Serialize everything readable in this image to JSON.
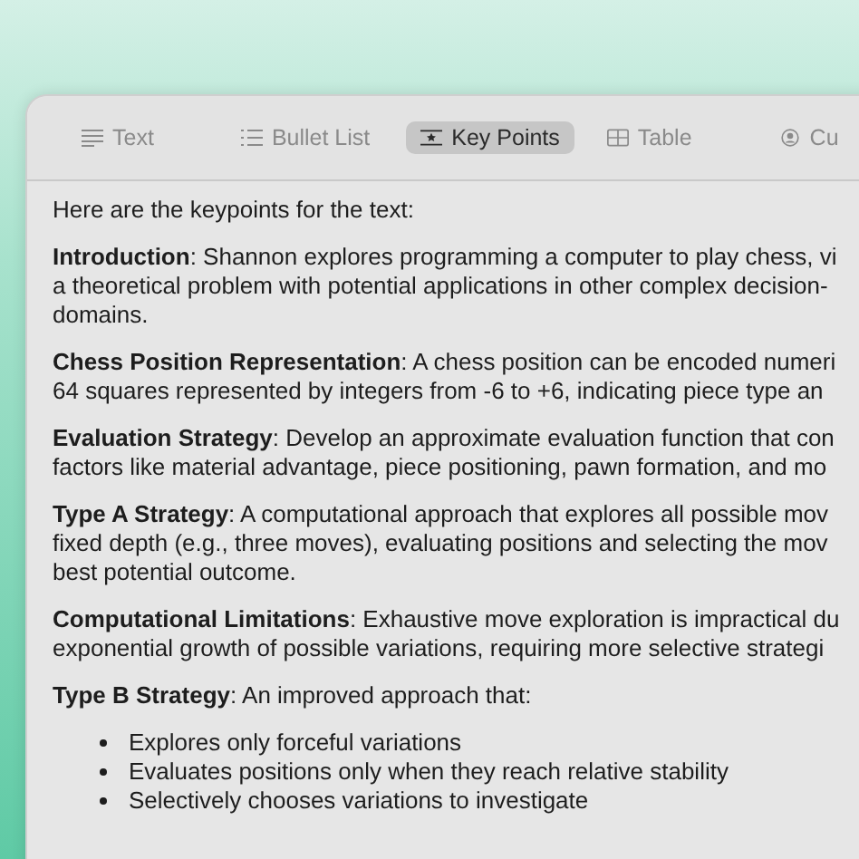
{
  "tabs": [
    {
      "label": "Text",
      "kind": "lines",
      "selected": false
    },
    {
      "label": "Bullet List",
      "kind": "list",
      "selected": false
    },
    {
      "label": "Key Points",
      "kind": "points",
      "selected": true
    },
    {
      "label": "Table",
      "kind": "table",
      "selected": false
    },
    {
      "label": "Cu",
      "kind": "custom",
      "selected": false
    }
  ],
  "intro": "Here are the keypoints for the text:",
  "sections": [
    {
      "lines": [
        "**Introduction**: Shannon explores programming a computer to play chess, vi",
        "a theoretical problem with potential applications in other complex decision-",
        "domains."
      ]
    },
    {
      "lines": [
        "**Chess Position Representation**: A chess position can be encoded numeri",
        "64 squares represented by integers from -6 to +6, indicating piece type an"
      ]
    },
    {
      "lines": [
        "**Evaluation Strategy**: Develop an approximate evaluation function that con",
        "factors like material advantage, piece positioning, pawn formation, and mo"
      ]
    },
    {
      "lines": [
        "**Type A Strategy**: A computational approach that explores all possible mov",
        "fixed depth (e.g., three moves), evaluating positions and selecting the mov",
        "best potential outcome."
      ]
    },
    {
      "lines": [
        "**Computational Limitations**: Exhaustive move exploration is impractical du",
        "exponential growth of possible variations, requiring more selective strategi"
      ]
    },
    {
      "lines": [
        "**Type B Strategy**: An improved approach that:"
      ]
    }
  ],
  "bullets": [
    "Explores only forceful variations",
    "Evaluates positions only when they reach relative stability",
    "Selectively chooses variations to investigate"
  ]
}
